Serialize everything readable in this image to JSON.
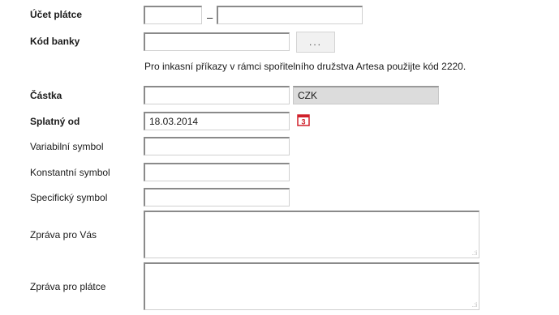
{
  "form": {
    "ucet_platce": {
      "label": "Účet plátce",
      "prefix_value": "",
      "number_value": "",
      "separator": "–"
    },
    "kod_banky": {
      "label": "Kód banky",
      "value": "",
      "browse_button": "..."
    },
    "hint": "Pro inkasní příkazy v rámci spořitelního družstva Artesa použijte kód 2220.",
    "castka": {
      "label": "Částka",
      "value": "",
      "currency": "CZK"
    },
    "splatny_od": {
      "label": "Splatný od",
      "value": "18.03.2014",
      "calendar_icon": "calendar-icon"
    },
    "variabilni_symbol": {
      "label": "Variabilní symbol",
      "value": ""
    },
    "konstantni_symbol": {
      "label": "Konstantní symbol",
      "value": ""
    },
    "specificky_symbol": {
      "label": "Specifický symbol",
      "value": ""
    },
    "zprava_pro_vas": {
      "label": "Zpráva pro Vás",
      "value": ""
    },
    "zprava_pro_platce": {
      "label": "Zpráva pro plátce",
      "value": ""
    }
  },
  "colors": {
    "calendar_red": "#d0202a",
    "currency_bg": "#dcdcdc"
  }
}
